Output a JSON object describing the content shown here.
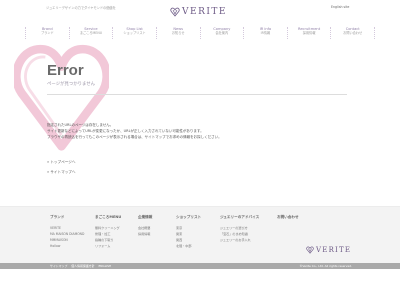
{
  "header": {
    "tagline": "ジュエリーデザインの力でダイヤモンドの価値を",
    "brand": "VERITE",
    "lang_link": "English site"
  },
  "nav": [
    {
      "en": "Brand",
      "ja": "ブランド"
    },
    {
      "en": "Service",
      "ja": "まごころMENU"
    },
    {
      "en": "Shop List",
      "ja": "ショップリスト"
    },
    {
      "en": "News",
      "ja": "お知らせ"
    },
    {
      "en": "Company",
      "ja": "会社案内"
    },
    {
      "en": "IR info",
      "ja": "IR情報"
    },
    {
      "en": "Recruitment",
      "ja": "採用情報"
    },
    {
      "en": "Contact",
      "ja": "お問い合わせ"
    }
  ],
  "error": {
    "title": "Error",
    "subtitle": "ページが見つかりません",
    "message_lines": [
      "指定されたURLのページは存在しません。",
      "サイト更新などによってURLが変更になったか、URLが正しく入力されていない可能性があります。",
      "ブラウザの再読込を行ってもこのページが表示される場合は、サイトマップでお求めの情報をお探しください。"
    ],
    "links": [
      "» トップページへ",
      "» サイトマップへ"
    ]
  },
  "footer": {
    "columns": [
      {
        "heading": "ブランド",
        "items": [
          "VERITE",
          "MA MAISON DIAMOND",
          "MMMAISON",
          "Hollow"
        ]
      },
      {
        "heading": "まごころMENU",
        "items": [
          "無料クリーニング",
          "修理・加工",
          "指輪の下取り",
          "リフォーム"
        ]
      },
      {
        "heading": "企業情報",
        "items": [
          "会社概要",
          "採用情報"
        ]
      },
      {
        "heading": "ショップリスト",
        "items": [
          "東京",
          "関東",
          "関西",
          "北陸・中部"
        ]
      },
      {
        "heading": "ジュエリーのアドバイス",
        "items": [
          "ジュエリーの選び方",
          "「宝石」のまめ知識",
          "ジュエリーのお手入れ"
        ]
      },
      {
        "heading": "お問い合わせ",
        "items": []
      }
    ],
    "brand": "VERITE",
    "bottom_links": [
      "サイトマップ",
      "個人情報保護方針",
      "ENGLISH"
    ],
    "copyright": "©Verite Co., Ltd. All rights reserved."
  },
  "colors": {
    "brand_purple": "#6d5a86",
    "heart_pink": "#f2c8d8",
    "footer_bg": "#f3f3f3",
    "bottom_bar": "#a9a9a9"
  }
}
